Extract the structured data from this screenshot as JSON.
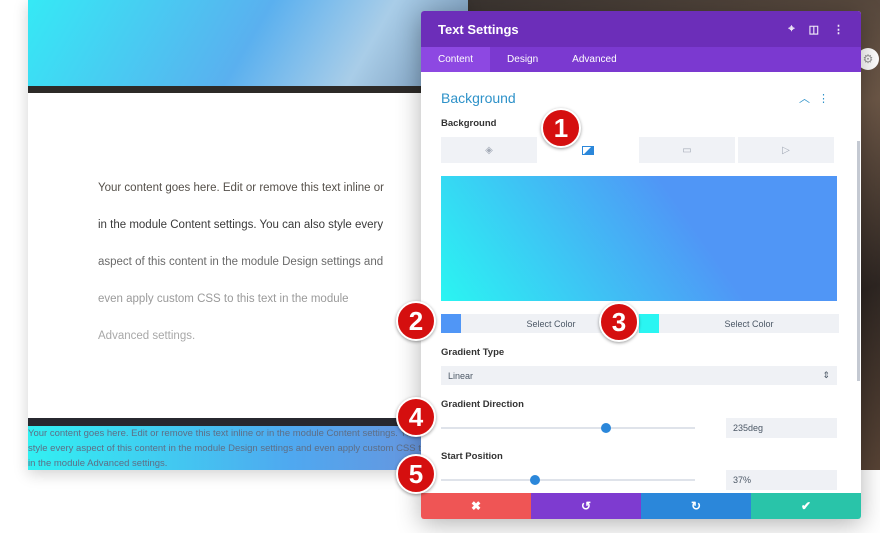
{
  "page": {
    "paragraph_lines": [
      "Your content goes here. Edit or remove this text inline or",
      "in the module Content settings. You can also style every",
      "aspect of this content in the module Design settings and",
      "even apply custom CSS to this text in the module",
      "Advanced settings."
    ],
    "bottom_text": "Your content goes here. Edit or remove this text inline or in the module Content settings. You can also style every aspect of this content in the module Design settings and even apply custom CSS to this text in the module Advanced settings."
  },
  "modal": {
    "title": "Text Settings",
    "header_icons": [
      "focus-icon",
      "split-view-icon",
      "more-vertical-icon"
    ],
    "tabs": [
      {
        "label": "Content",
        "active": true
      },
      {
        "label": "Design"
      },
      {
        "label": "Advanced"
      }
    ],
    "section_title": "Background",
    "background_label": "Background",
    "bg_type_tabs": [
      "color-icon",
      "gradient-icon",
      "image-icon",
      "video-icon"
    ],
    "bg_type_active": "gradient",
    "gradient": {
      "color1": "#5096f6",
      "color2": "#2af5f2",
      "select_color_label": "Select Color"
    },
    "gradient_type": {
      "label": "Gradient Type",
      "value": "Linear"
    },
    "gradient_direction": {
      "label": "Gradient Direction",
      "value": "235deg",
      "fraction": 0.65
    },
    "start_position": {
      "label": "Start Position",
      "value": "37%",
      "fraction": 0.37
    },
    "footer": {
      "cancel": "✖",
      "undo": "↺",
      "redo": "↻",
      "save": "✔",
      "colors": [
        "#ef5555",
        "#7e3bd0",
        "#2b87da",
        "#29c4a9"
      ]
    }
  },
  "badges": [
    "1",
    "2",
    "3",
    "4",
    "5"
  ]
}
